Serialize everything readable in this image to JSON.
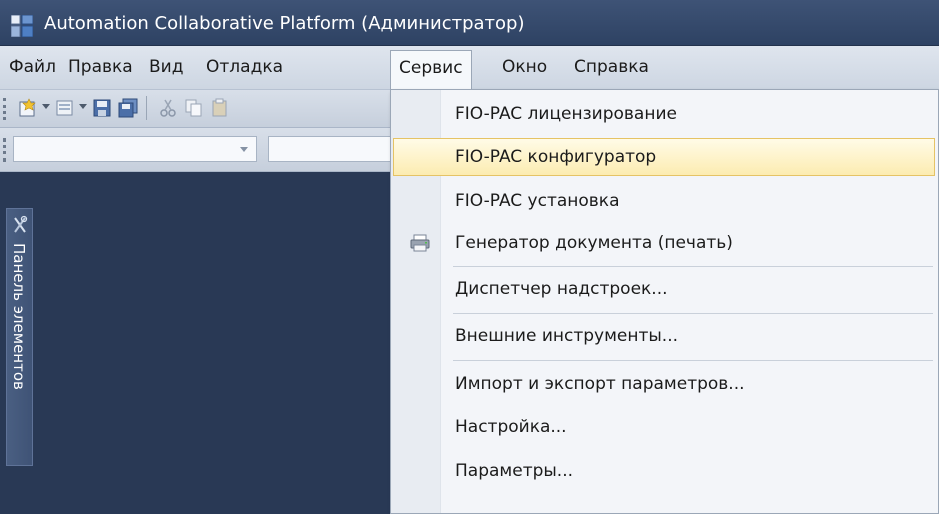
{
  "window": {
    "title": "Automation Collaborative Platform (Администратор)",
    "app_icon": "acp-app-icon"
  },
  "menubar": {
    "items": [
      {
        "label": "Файл"
      },
      {
        "label": "Правка"
      },
      {
        "label": "Вид"
      },
      {
        "label": "Отладка"
      },
      {
        "label": "Сервис",
        "active": true
      },
      {
        "label": "Окно"
      },
      {
        "label": "Справка"
      }
    ]
  },
  "toolbar": {
    "icons": [
      "new-project-icon",
      "add-item-icon",
      "save-icon",
      "save-all-icon",
      "cut-icon",
      "copy-icon",
      "paste-icon"
    ]
  },
  "side_panel": {
    "label": "Панель элементов",
    "icon": "toolbox-icon"
  },
  "service_menu": {
    "items": [
      {
        "label": "FIO-PAC лицензирование"
      },
      {
        "label": "FIO-PAC конфигуратор",
        "highlighted": true
      },
      {
        "label": "FIO-PAC установка"
      },
      {
        "label": "Генератор документа (печать)",
        "icon": "printer-icon"
      },
      {
        "label": "Диспетчер надстроек..."
      },
      {
        "label": "Внешние инструменты..."
      },
      {
        "label": "Импорт и экспорт параметров..."
      },
      {
        "label": "Настройка..."
      },
      {
        "label": "Параметры..."
      }
    ]
  },
  "colors": {
    "background": "#293955",
    "menu_highlight": "#fcecb1",
    "menu_background": "#f3f5f9"
  }
}
